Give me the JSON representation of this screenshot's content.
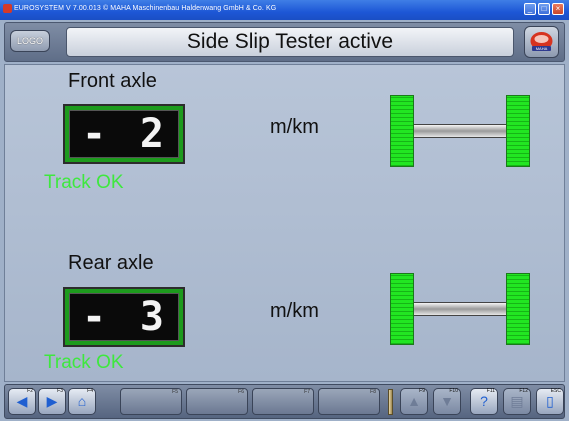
{
  "window": {
    "title": "EUROSYSTEM  V 7.00.013  © MAHA Maschinenbau Haldenwang GmbH & Co. KG"
  },
  "header": {
    "logo_label": "LOGO",
    "title": "Side Slip Tester active"
  },
  "front_axle": {
    "label": "Front axle",
    "sign": "-",
    "value": "2",
    "unit": "m/km",
    "status": "Track OK"
  },
  "rear_axle": {
    "label": "Rear axle",
    "sign": "-",
    "value": "3",
    "unit": "m/km",
    "status": "Track OK"
  },
  "toolbar": {
    "keys": [
      "F2",
      "F3",
      "F4",
      "F5",
      "F6",
      "F7",
      "F8",
      "F9",
      "F10",
      "F11",
      "F12",
      "ESC"
    ]
  },
  "colors": {
    "status_ok": "#3ee83e",
    "lcd_frame": "#1d9b1d",
    "wheel": "#22e622",
    "accent": "#1f5fd1"
  },
  "icons": [
    "back-arrow-icon",
    "forward-arrow-icon",
    "home-icon",
    "up-arrow-icon",
    "down-arrow-icon",
    "help-icon",
    "print-icon",
    "exit-icon",
    "maha-logo-icon"
  ]
}
